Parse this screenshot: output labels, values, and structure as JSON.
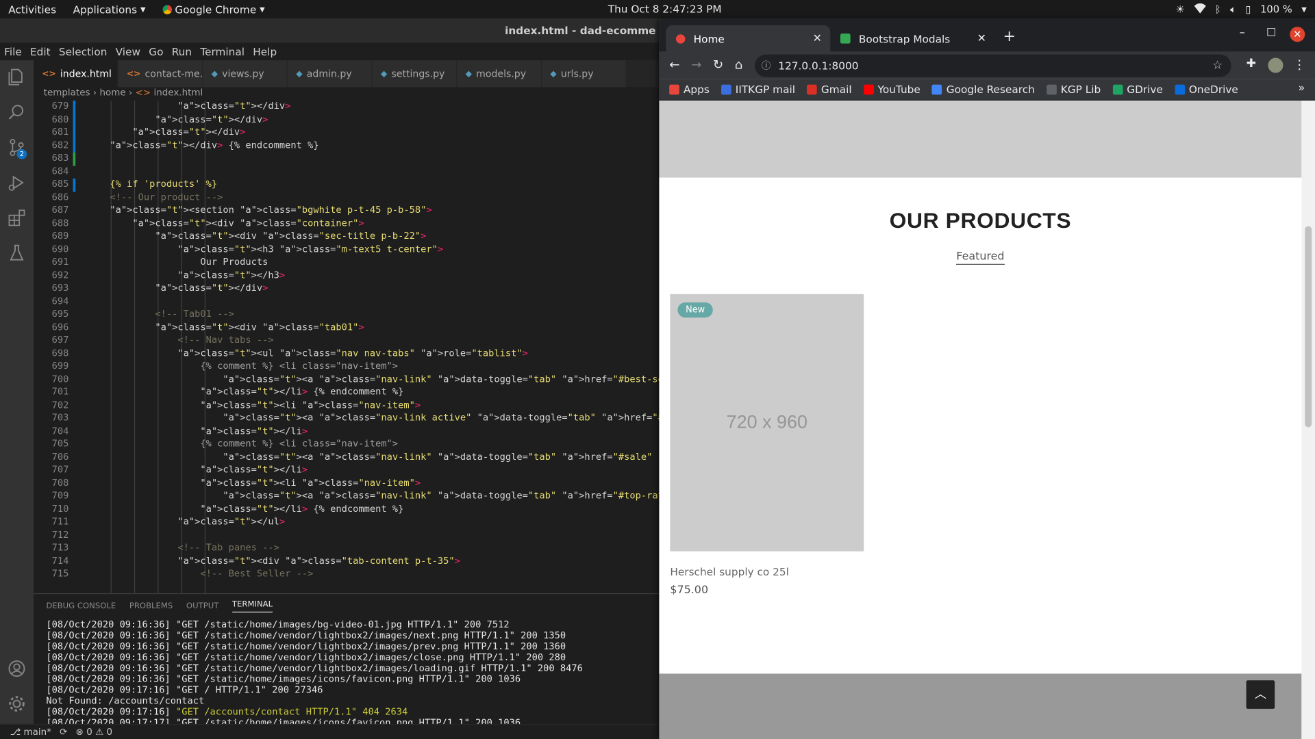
{
  "system_bar": {
    "activities": "Activities",
    "applications": "Applications",
    "active_app": "Google Chrome",
    "clock": "Thu Oct 8   2:47:23 PM",
    "battery": "100 %"
  },
  "vscode": {
    "title": "index.html - dad-ecomme",
    "menu": [
      "File",
      "Edit",
      "Selection",
      "View",
      "Go",
      "Run",
      "Terminal",
      "Help"
    ],
    "tabs": [
      {
        "label": "index.html",
        "type": "html",
        "active": true
      },
      {
        "label": "contact-me.html",
        "type": "html"
      },
      {
        "label": "views.py",
        "type": "py"
      },
      {
        "label": "admin.py",
        "type": "py"
      },
      {
        "label": "settings.py",
        "type": "py"
      },
      {
        "label": "models.py",
        "type": "py"
      },
      {
        "label": "urls.py",
        "type": "py"
      }
    ],
    "breadcrumb": {
      "part1": "templates",
      "part2": "home",
      "part3": "index.html"
    },
    "scm_badge": "2",
    "code_lines": [
      {
        "num": "679",
        "text": "            </div>"
      },
      {
        "num": "680",
        "text": "        </div>"
      },
      {
        "num": "681",
        "text": "    </div>"
      },
      {
        "num": "682",
        "text": "</div> {% endcomment %}"
      },
      {
        "num": "683",
        "text": ""
      },
      {
        "num": "684",
        "text": ""
      },
      {
        "num": "685",
        "text": "{% if 'products' %}"
      },
      {
        "num": "686",
        "text": "<!-- Our product -->"
      },
      {
        "num": "687",
        "text": "<section class=\"bgwhite p-t-45 p-b-58\">"
      },
      {
        "num": "688",
        "text": "    <div class=\"container\">"
      },
      {
        "num": "689",
        "text": "        <div class=\"sec-title p-b-22\">"
      },
      {
        "num": "690",
        "text": "            <h3 class=\"m-text5 t-center\">"
      },
      {
        "num": "691",
        "text": "                Our Products"
      },
      {
        "num": "692",
        "text": "            </h3>"
      },
      {
        "num": "693",
        "text": "        </div>"
      },
      {
        "num": "694",
        "text": ""
      },
      {
        "num": "695",
        "text": "        <!-- Tab01 -->"
      },
      {
        "num": "696",
        "text": "        <div class=\"tab01\">"
      },
      {
        "num": "697",
        "text": "            <!-- Nav tabs -->"
      },
      {
        "num": "698",
        "text": "            <ul class=\"nav nav-tabs\" role=\"tablist\">"
      },
      {
        "num": "699",
        "text": "                {% comment %} <li class=\"nav-item\">"
      },
      {
        "num": "700",
        "text": "                    <a class=\"nav-link\" data-toggle=\"tab\" href=\"#best-seller\" role=\"tab\">Best S"
      },
      {
        "num": "701",
        "text": "                </li> {% endcomment %}"
      },
      {
        "num": "702",
        "text": "                <li class=\"nav-item\">"
      },
      {
        "num": "703",
        "text": "                    <a class=\"nav-link active\" data-toggle=\"tab\" href=\"#featured\" role=\"tab\">Fe"
      },
      {
        "num": "704",
        "text": "                </li>"
      },
      {
        "num": "705",
        "text": "                {% comment %} <li class=\"nav-item\">"
      },
      {
        "num": "706",
        "text": "                    <a class=\"nav-link\" data-toggle=\"tab\" href=\"#sale\" role=\"tab\">Sale</a>"
      },
      {
        "num": "707",
        "text": "                </li>"
      },
      {
        "num": "708",
        "text": "                <li class=\"nav-item\">"
      },
      {
        "num": "709",
        "text": "                    <a class=\"nav-link\" data-toggle=\"tab\" href=\"#top-rate\" role=\"tab\">Top Rate<"
      },
      {
        "num": "710",
        "text": "                </li> {% endcomment %}"
      },
      {
        "num": "711",
        "text": "            </ul>"
      },
      {
        "num": "712",
        "text": ""
      },
      {
        "num": "713",
        "text": "            <!-- Tab panes -->"
      },
      {
        "num": "714",
        "text": "            <div class=\"tab-content p-t-35\">"
      },
      {
        "num": "715",
        "text": "                <!-- Best Seller -->"
      }
    ],
    "panel_tabs": [
      "DEBUG CONSOLE",
      "PROBLEMS",
      "OUTPUT",
      "TERMINAL"
    ],
    "terminal_lines": [
      "[08/Oct/2020 09:16:36] \"GET /static/home/images/bg-video-01.jpg HTTP/1.1\" 200 7512",
      "[08/Oct/2020 09:16:36] \"GET /static/home/vendor/lightbox2/images/next.png HTTP/1.1\" 200 1350",
      "[08/Oct/2020 09:16:36] \"GET /static/home/vendor/lightbox2/images/prev.png HTTP/1.1\" 200 1360",
      "[08/Oct/2020 09:16:36] \"GET /static/home/vendor/lightbox2/images/close.png HTTP/1.1\" 200 280",
      "[08/Oct/2020 09:16:36] \"GET /static/home/vendor/lightbox2/images/loading.gif HTTP/1.1\" 200 8476",
      "[08/Oct/2020 09:16:36] \"GET /static/home/images/icons/favicon.png HTTP/1.1\" 200 1036",
      "[08/Oct/2020 09:17:16] \"GET / HTTP/1.1\" 200 27346",
      "Not Found: /accounts/contact",
      "[08/Oct/2020 09:17:16] \"GET /accounts/contact HTTP/1.1\" 404 2634",
      "[08/Oct/2020 09:17:17] \"GET /static/home/images/icons/favicon.png HTTP/1.1\" 200 1036",
      "_"
    ],
    "status": {
      "branch": "main*",
      "errors": "0",
      "warnings": "0"
    }
  },
  "chrome": {
    "tabs": [
      {
        "label": "Home"
      },
      {
        "label": "Bootstrap Modals"
      }
    ],
    "url": "127.0.0.1:8000",
    "bookmarks": [
      {
        "label": "Apps",
        "color": "#e8453c"
      },
      {
        "label": "IITKGP mail",
        "color": "#3b6fe0"
      },
      {
        "label": "Gmail",
        "color": "#d93025"
      },
      {
        "label": "YouTube",
        "color": "#ff0000"
      },
      {
        "label": "Google Research",
        "color": "#4285f4"
      },
      {
        "label": "KGP Lib",
        "color": "#5f6368"
      },
      {
        "label": "GDrive",
        "color": "#1fa463"
      },
      {
        "label": "OneDrive",
        "color": "#0a6cdb"
      }
    ],
    "page": {
      "heading": "OUR PRODUCTS",
      "active_tab": "Featured",
      "products": [
        {
          "badge": "New",
          "placeholder": "720 x 960",
          "name": "Herschel supply co 25l",
          "price": "$75.00"
        }
      ]
    }
  }
}
